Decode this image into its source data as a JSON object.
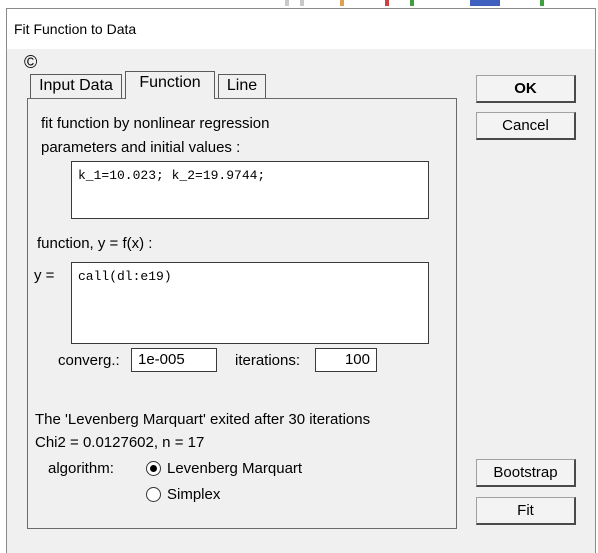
{
  "window": {
    "title": "Fit Function to Data",
    "copyright_symbol": "©"
  },
  "tabs": [
    {
      "label": "Input Data",
      "active": false
    },
    {
      "label": "Function",
      "active": true
    },
    {
      "label": "Line",
      "active": false
    }
  ],
  "panel": {
    "heading": "fit function by nonlinear regression",
    "params_label": "parameters and initial values :",
    "params_value": "k_1=10.023; k_2=19.9744;",
    "function_label": "function, y = f(x) :",
    "y_label": "y =",
    "function_value": "call(dl:e19)",
    "converg_label": "converg.:",
    "converg_value": "1e-005",
    "iterations_label": "iterations:",
    "iterations_value": "100",
    "status_line": "The 'Levenberg Marquart' exited after 30 iterations",
    "chi_line": "Chi2 = 0.0127602, n = 17",
    "algorithm_label": "algorithm:",
    "algorithms": [
      {
        "label": "Levenberg Marquart",
        "selected": true
      },
      {
        "label": "Simplex",
        "selected": false
      }
    ]
  },
  "buttons": {
    "ok": "OK",
    "cancel": "Cancel",
    "bootstrap": "Bootstrap",
    "fit": "Fit"
  },
  "colors": {
    "dialog_bg": "#f0f0f0",
    "title_bg": "#ffffff",
    "border": "#5a5a5a"
  }
}
